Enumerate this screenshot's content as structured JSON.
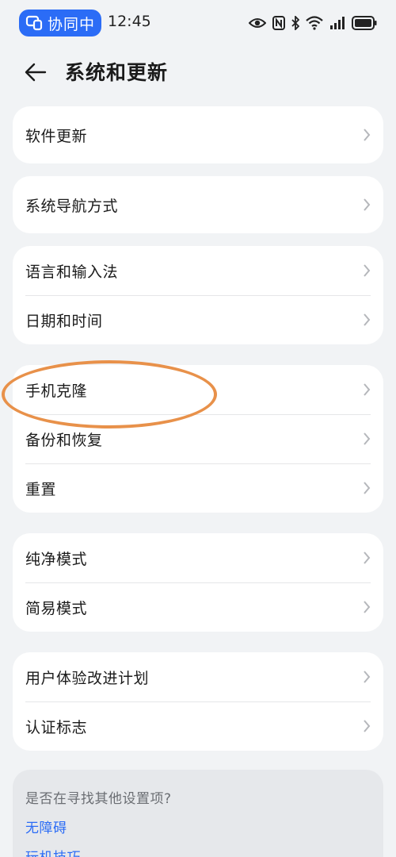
{
  "status_bar": {
    "collab_label": "协同中",
    "time": "12:45",
    "icons": [
      "eye-icon",
      "nfc-icon",
      "bluetooth-icon",
      "wifi-icon",
      "signal-icon",
      "battery-icon"
    ]
  },
  "header": {
    "title": "系统和更新",
    "back_icon": "back-arrow-icon"
  },
  "groups": [
    {
      "items": [
        "软件更新"
      ]
    },
    {
      "items": [
        "系统导航方式"
      ]
    },
    {
      "items": [
        "语言和输入法",
        "日期和时间"
      ]
    },
    {
      "items": [
        "手机克隆",
        "备份和恢复",
        "重置"
      ]
    },
    {
      "items": [
        "纯净模式",
        "简易模式"
      ]
    },
    {
      "items": [
        "用户体验改进计划",
        "认证标志"
      ]
    }
  ],
  "annotation": {
    "highlighted_item": "手机克隆",
    "color": "#e8914a"
  },
  "suggestions": {
    "question": "是否在寻找其他设置项?",
    "links": [
      "无障碍",
      "玩机技巧"
    ]
  },
  "colors": {
    "accent": "#2b6cf6",
    "background": "#f1f3f5",
    "card": "#ffffff"
  }
}
